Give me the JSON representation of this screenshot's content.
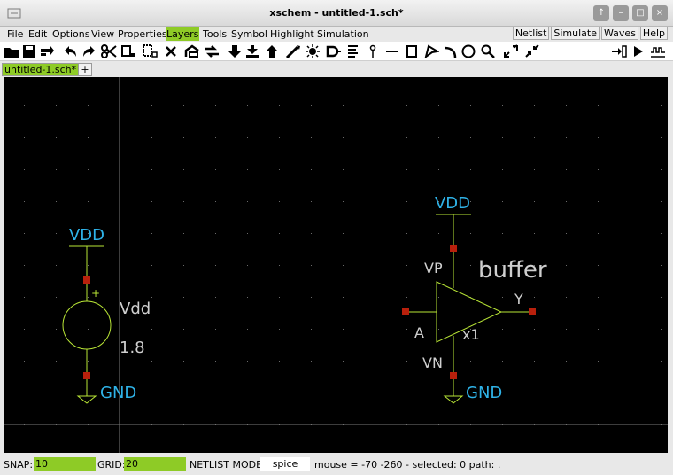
{
  "window": {
    "title": "xschem - untitled-1.sch*",
    "controls": [
      "↑",
      "–",
      "□",
      "×"
    ]
  },
  "menubar": {
    "items": [
      "File",
      "Edit",
      "Options",
      "View",
      "Properties",
      "Layers",
      "Tools",
      "Symbol",
      "Highlight",
      "Simulation"
    ],
    "active_item": "Layers",
    "right_buttons": [
      "Netlist",
      "Simulate",
      "Waves",
      "Help"
    ]
  },
  "toolbar": {
    "icons": [
      "open-folder-icon",
      "save-icon",
      "reload-icon",
      "undo-icon",
      "redo-icon",
      "cut-icon",
      "copy-icon",
      "move-icon",
      "delete-icon",
      "push-icon",
      "pop-icon",
      "descend-icon",
      "make-symbol-icon",
      "ascend-icon",
      "wire-icon",
      "highlight-icon",
      "netlist-icon",
      "text-icon",
      "pin-icon",
      "line-icon",
      "rect-icon",
      "polygon-icon",
      "arc-icon",
      "circle-icon",
      "search-icon",
      "zoom-in-icon",
      "zoom-out-icon",
      "insert-icon",
      "run-icon",
      "waves-icon"
    ]
  },
  "tabs": {
    "active": "untitled-1.sch*",
    "add": "+"
  },
  "colors": {
    "accent_green": "#8ecb26",
    "wire": "#b9e636",
    "net_label": "#2fb3e8",
    "pin": "#b8200c",
    "component_text": "#cfcfcf"
  },
  "schematic": {
    "vsource": {
      "top_label": "VDD",
      "name": "Vdd",
      "value": "1.8",
      "plus": "+",
      "bottom_label": "GND"
    },
    "buffer": {
      "top_label": "VDD",
      "name": "buffer",
      "pin_vp": "VP",
      "pin_vn": "VN",
      "pin_a": "A",
      "pin_y": "Y",
      "instance": "x1",
      "bottom_label": "GND"
    }
  },
  "statusbar": {
    "snap_label": "SNAP:",
    "snap_value": "10",
    "grid_label": "GRID:",
    "grid_value": "20",
    "netlist_label": "NETLIST MODE:",
    "netlist_value": "spice",
    "status_text": "mouse = -70 -260 - selected: 0 path: ."
  }
}
